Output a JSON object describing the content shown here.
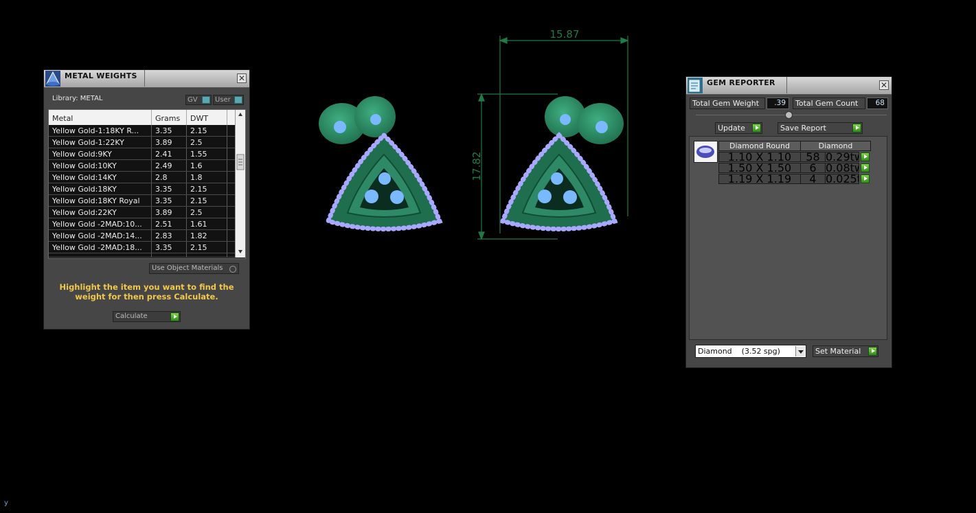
{
  "metal_weights": {
    "title": "METAL WEIGHTS",
    "library_label": "Library: METAL",
    "toggle_gv": "GV",
    "toggle_user": "User",
    "columns": [
      "Metal",
      "Grams",
      "DWT"
    ],
    "rows": [
      {
        "metal": "Yellow Gold-1:18KY R...",
        "grams": "3.35",
        "dwt": "2.15"
      },
      {
        "metal": "Yellow Gold-1:22KY",
        "grams": "3.89",
        "dwt": "2.5"
      },
      {
        "metal": "Yellow Gold:9KY",
        "grams": "2.41",
        "dwt": "1.55"
      },
      {
        "metal": "Yellow Gold:10KY",
        "grams": "2.49",
        "dwt": "1.6"
      },
      {
        "metal": "Yellow Gold:14KY",
        "grams": "2.8",
        "dwt": "1.8"
      },
      {
        "metal": "Yellow Gold:18KY",
        "grams": "3.35",
        "dwt": "2.15"
      },
      {
        "metal": "Yellow Gold:18KY Royal",
        "grams": "3.35",
        "dwt": "2.15"
      },
      {
        "metal": "Yellow Gold:22KY",
        "grams": "3.89",
        "dwt": "2.5"
      },
      {
        "metal": "Yellow Gold -2MAD:10...",
        "grams": "2.51",
        "dwt": "1.61"
      },
      {
        "metal": "Yellow Gold -2MAD:14...",
        "grams": "2.83",
        "dwt": "1.82"
      },
      {
        "metal": "Yellow Gold -2MAD:18...",
        "grams": "3.35",
        "dwt": "2.15"
      }
    ],
    "use_object_materials": "Use Object Materials",
    "instruction": "Highlight the item you want to find the weight for then press Calculate.",
    "calculate_label": "Calculate"
  },
  "viewport": {
    "dim_width": "15.87",
    "dim_height": "17.82",
    "colors": {
      "metal": "#2e8a66",
      "stone_outer": "#a8a8ff",
      "stone_purple": "#8a2ad0",
      "center": "#7ab8ff",
      "dim_line": "#1f7a46"
    }
  },
  "gem_reporter": {
    "title": "GEM REPORTER",
    "total_weight_label": "Total Gem Weight",
    "total_weight_value": ".39",
    "total_count_label": "Total Gem Count",
    "total_count_value": "68",
    "update_label": "Update",
    "save_report_label": "Save Report",
    "table_headers": [
      "Diamond Round",
      "Diamond"
    ],
    "rows": [
      {
        "size": "1.10 X 1.10",
        "count": "58",
        "weight": "0.29tw"
      },
      {
        "size": "1.50 X 1.50",
        "count": "6",
        "weight": "0.08tw"
      },
      {
        "size": "1.19 X 1.19",
        "count": "4",
        "weight": "0.025tw"
      }
    ],
    "material_select": "Diamond    (3.52 spg)",
    "set_material_label": "Set Material"
  },
  "corner_glyph": "y"
}
